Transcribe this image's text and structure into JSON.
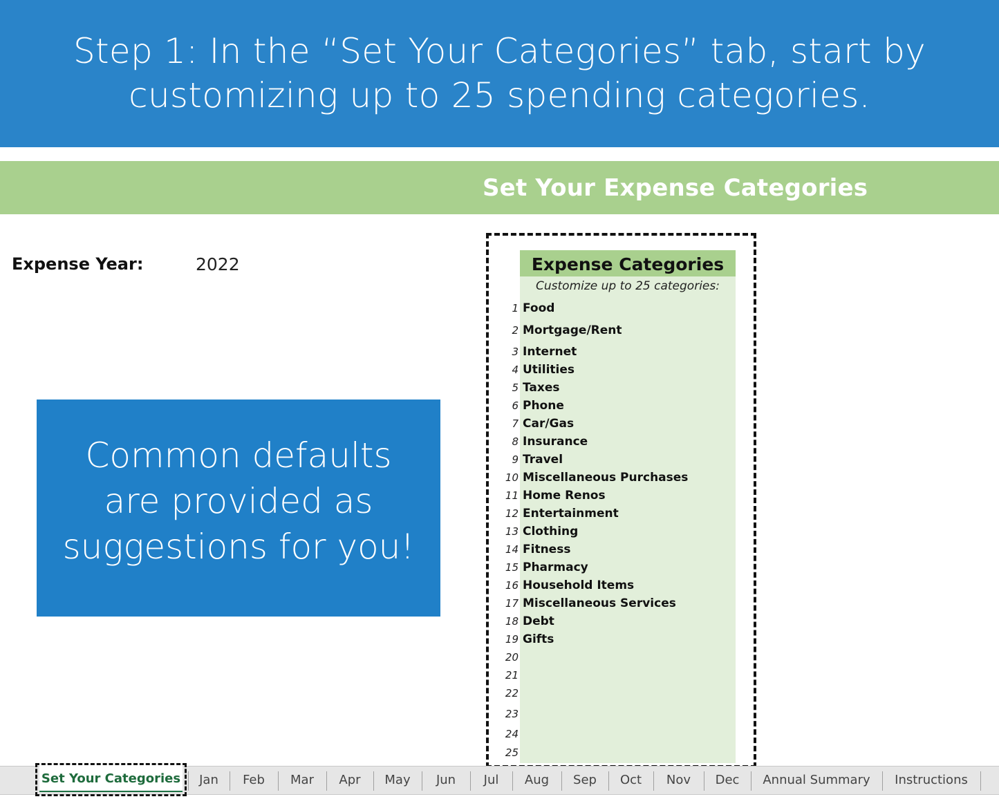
{
  "banner": {
    "line1": "Step 1: In the “Set Your Categories” tab, start by",
    "line2": "customizing up to 25 spending categories.",
    "color": "#2A84C9"
  },
  "sheet": {
    "band_title": "Set Your Expense Categories",
    "band_color": "#A9D08E",
    "expense_year_label": "Expense Year:",
    "expense_year_value": "2022"
  },
  "callout": {
    "line1": "Common defaults",
    "line2": "are provided as",
    "line3": "suggestions for you!",
    "color": "#2080C8"
  },
  "categories": {
    "title": "Expense Categories",
    "subtitle": "Customize up to 25 categories:",
    "body_color": "#E2EFDA",
    "rows": [
      {
        "num": "1",
        "name": "Food"
      },
      {
        "num": "2",
        "name": "Mortgage/Rent"
      },
      {
        "num": "3",
        "name": "Internet"
      },
      {
        "num": "4",
        "name": "Utilities"
      },
      {
        "num": "5",
        "name": "Taxes"
      },
      {
        "num": "6",
        "name": "Phone"
      },
      {
        "num": "7",
        "name": "Car/Gas"
      },
      {
        "num": "8",
        "name": "Insurance"
      },
      {
        "num": "9",
        "name": "Travel"
      },
      {
        "num": "10",
        "name": "Miscellaneous Purchases"
      },
      {
        "num": "11",
        "name": "Home Renos"
      },
      {
        "num": "12",
        "name": "Entertainment"
      },
      {
        "num": "13",
        "name": "Clothing"
      },
      {
        "num": "14",
        "name": "Fitness"
      },
      {
        "num": "15",
        "name": "Pharmacy"
      },
      {
        "num": "16",
        "name": "Household Items"
      },
      {
        "num": "17",
        "name": "Miscellaneous Services"
      },
      {
        "num": "18",
        "name": "Debt"
      },
      {
        "num": "19",
        "name": "Gifts"
      },
      {
        "num": "20",
        "name": ""
      },
      {
        "num": "21",
        "name": ""
      },
      {
        "num": "22",
        "name": ""
      },
      {
        "num": "23",
        "name": ""
      },
      {
        "num": "24",
        "name": ""
      },
      {
        "num": "25",
        "name": ""
      }
    ]
  },
  "tabs": {
    "active": "Set Your Categories",
    "items": [
      "Jan",
      "Feb",
      "Mar",
      "Apr",
      "May",
      "Jun",
      "Jul",
      "Aug",
      "Sep",
      "Oct",
      "Nov",
      "Dec",
      "Annual Summary",
      "Instructions"
    ]
  }
}
